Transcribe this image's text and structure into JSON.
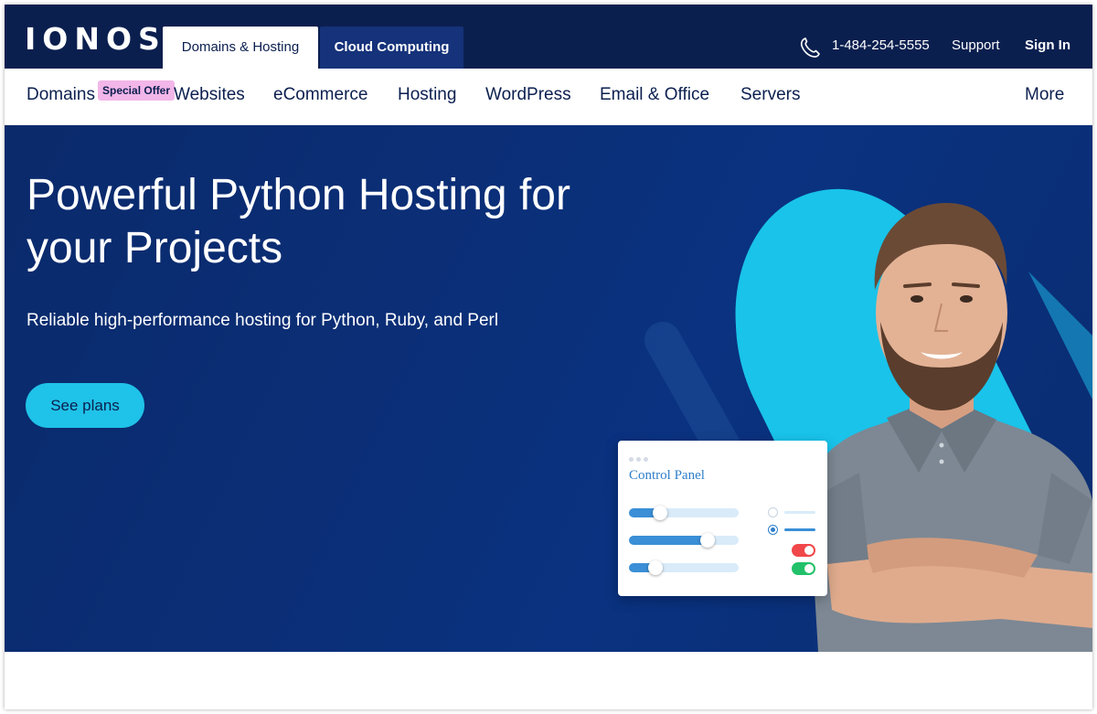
{
  "brand": {
    "logo_text": "IONOS",
    "navy": "#0b1f4f",
    "accent": "#1fc2e8"
  },
  "top_tabs": [
    {
      "label": "Domains & Hosting",
      "active": true
    },
    {
      "label": "Cloud Computing",
      "active": false
    }
  ],
  "top_right": {
    "phone_icon": "phone-icon",
    "phone": "1-484-254-5555",
    "support": "Support",
    "sign_in": "Sign In"
  },
  "nav": {
    "badge": "Special Offer",
    "items": [
      "Domains & SSL",
      "Websites",
      "eCommerce",
      "Hosting",
      "WordPress",
      "Email & Office",
      "Servers"
    ],
    "more": "More"
  },
  "hero": {
    "title": "Powerful Python Hosting for your Projects",
    "subtitle": "Reliable high-performance hosting for Python, Ruby, and Perl",
    "cta": "See plans"
  },
  "control_panel": {
    "title": "Control Panel",
    "sliders": [
      0.28,
      0.72,
      0.24
    ],
    "radios": [
      false,
      true
    ],
    "toggles": [
      {
        "state": "on",
        "color": "#f0474a"
      },
      {
        "state": "on",
        "color": "#22c169"
      }
    ]
  }
}
